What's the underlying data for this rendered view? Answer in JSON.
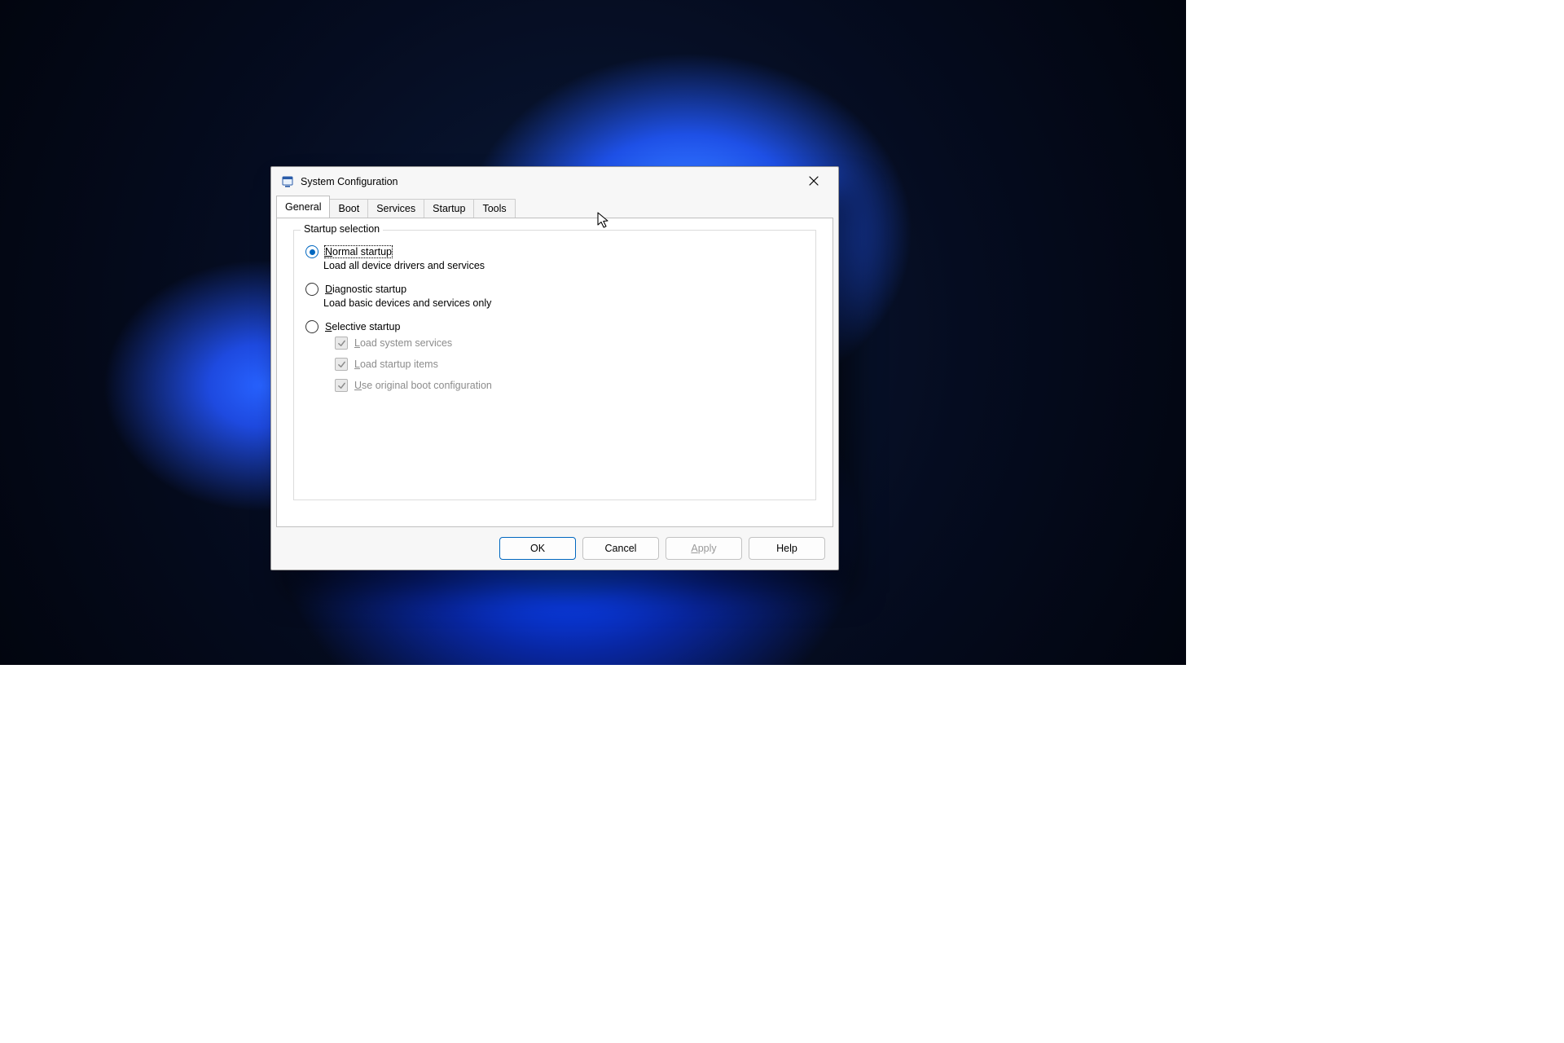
{
  "window": {
    "title": "System Configuration"
  },
  "tabs": {
    "general": "General",
    "boot": "Boot",
    "services": "Services",
    "startup": "Startup",
    "tools": "Tools",
    "active": "General"
  },
  "group": {
    "legend": "Startup selection",
    "normal": {
      "label_pre": "N",
      "label_rest": "ormal startup",
      "desc": "Load all device drivers and services",
      "selected": true
    },
    "diagnostic": {
      "label_pre": "D",
      "label_rest": "iagnostic startup",
      "desc": "Load basic devices and services only",
      "selected": false
    },
    "selective": {
      "label_pre": "S",
      "label_rest": "elective startup",
      "selected": false,
      "load_system_pre": "L",
      "load_system_rest": "oad system services",
      "load_startup_pre": "",
      "load_startup_mid": "L",
      "load_startup_rest": "oad startup items",
      "use_original_pre": "U",
      "use_original_rest": "se original boot configuration"
    }
  },
  "buttons": {
    "ok": "OK",
    "cancel": "Cancel",
    "apply_pre": "A",
    "apply_rest": "pply",
    "help": "Help"
  }
}
